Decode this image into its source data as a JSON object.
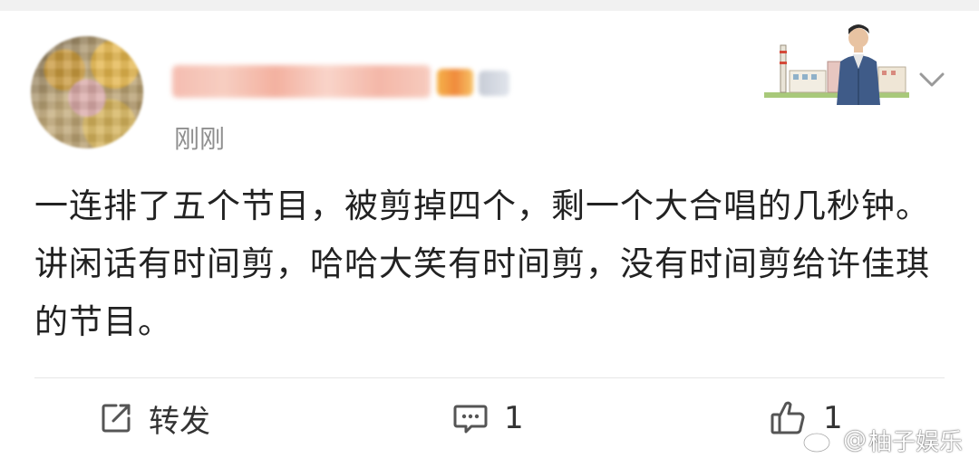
{
  "post": {
    "timestamp": "刚刚",
    "text": "一连排了五个节目，被剪掉四个，剩一个大合唱的几秒钟。讲闲话有时间剪，哈哈大笑有时间剪，没有时间剪给许佳琪的节目。"
  },
  "actions": {
    "repost_label": "转发",
    "comment_count": "1",
    "like_count": "1"
  },
  "watermark": {
    "at": "@",
    "text": "柚子娱乐"
  },
  "icons": {
    "repost": "repost-icon",
    "comment": "comment-icon",
    "like": "thumbs-up-icon",
    "more": "chevron-down-icon",
    "weibo_logo": "weibo-logo-icon"
  },
  "colors": {
    "text": "#222222",
    "timestamp": "#8f8f8f",
    "divider": "#e6e6e6",
    "icon": "#555555"
  }
}
